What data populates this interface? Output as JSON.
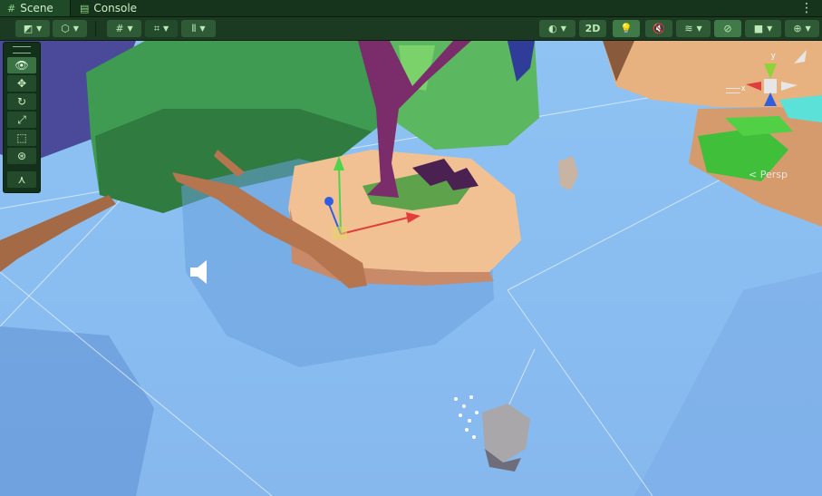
{
  "tabs": [
    {
      "label": "Scene",
      "icon": "scene-grid-icon",
      "active": true
    },
    {
      "label": "Console",
      "icon": "console-icon",
      "active": false
    }
  ],
  "toolbar": {
    "two_d_label": "2D"
  },
  "overlay_tools": [
    {
      "name": "view-tool",
      "icon": "eye-icon",
      "active": true
    },
    {
      "name": "move-tool",
      "icon": "move-arrows-icon",
      "active": false
    },
    {
      "name": "rotate-tool",
      "icon": "rotate-icon",
      "active": false
    },
    {
      "name": "scale-tool",
      "icon": "scale-icon",
      "active": false
    },
    {
      "name": "rect-tool",
      "icon": "rect-transform-icon",
      "active": false
    },
    {
      "name": "transform-tool",
      "icon": "transform-icon",
      "active": false
    },
    {
      "name": "custom-tool",
      "icon": "custom-tool-icon",
      "active": false
    }
  ],
  "gizmo": {
    "label": "< Persp"
  },
  "colors": {
    "tab_bg": "#16341c",
    "toolbar_bg": "#1c3a22",
    "water": "#8cbef0",
    "accent_green": "#3f7a48"
  }
}
